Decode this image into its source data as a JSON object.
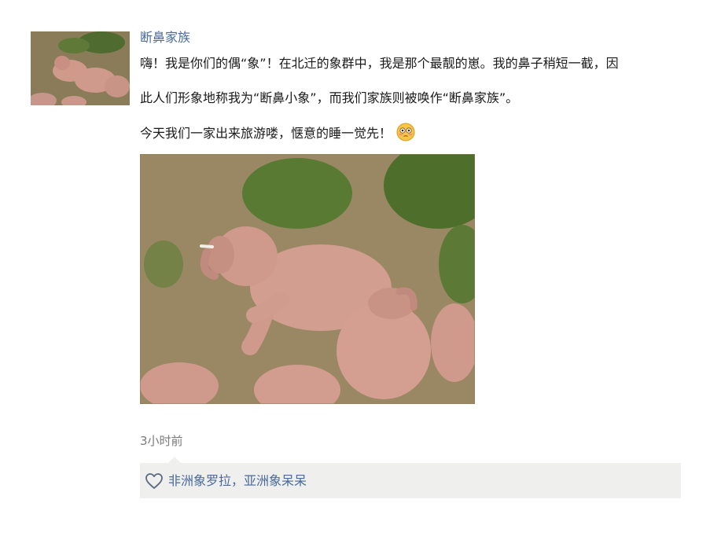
{
  "post": {
    "author": "断鼻家族",
    "text_line1": "嗨！我是你们的偶“象”！在北迁的象群中，我是那个最靓的崽。我的鼻子稍短一截，因",
    "text_line2": "此人们形象地称我为“断鼻小象”，而我们家族则被唤作“断鼻家族”。",
    "text_line3": "今天我们一家出来旅游喽，惬意的睡一觉先！",
    "time": "3小时前",
    "likes": "非洲象罗拉，亚洲象呆呆",
    "icons": {
      "emoji": "flushed-face-icon",
      "like": "heart-icon"
    },
    "colors": {
      "name": "#4a6a9c",
      "like_bg": "#efefed"
    }
  }
}
